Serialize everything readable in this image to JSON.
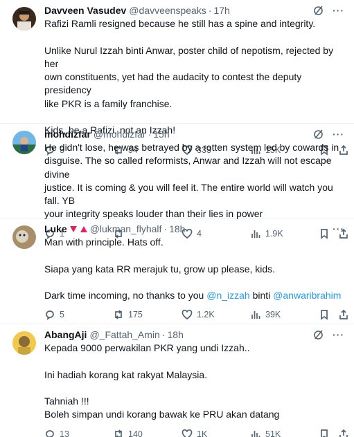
{
  "tweets": [
    {
      "name": "Davveen Vasudev",
      "handle": "@davveenspeaks",
      "time": "17h",
      "lines": [
        "Rafizi Ramli resigned because he still has a spine and integrity.",
        "",
        "Unlike Nurul Izzah binti Anwar, poster child of nepotism, rejected by her",
        "own constituents, yet had the audacity to contest the deputy presidency",
        "like PKR is a family franchise.",
        "",
        "Kids, be a Rafizi, not an Izzah!"
      ],
      "replies": "3",
      "reposts": "54",
      "likes": "333",
      "views": "15K"
    },
    {
      "name": "mohdizfar",
      "handle": "@mohdizfar",
      "time": "15h",
      "lines": [
        "He didn't lose, he was betrayed by a rotten system led by cowards in",
        "disguise. The so called reformists, Anwar and Izzah will not escape divine",
        "justice. It is coming & you will feel it. The entire world will watch you fall. YB",
        "your integrity speaks louder than their lies in power"
      ],
      "replies": "1",
      "reposts": "",
      "likes": "4",
      "views": "1.9K"
    },
    {
      "name": "Luke",
      "handle": "@lukman_flyhalf",
      "time": "18h",
      "lines": [
        "Man with principle. Hats off.",
        "",
        "Siapa yang kata RR merajuk tu, grow up please, kids.",
        ""
      ],
      "last_line_prefix": "Dark time incoming, no thanks to you ",
      "mention1": "@n_izzah",
      "last_line_mid": " binti ",
      "mention2": "@anwaribrahim",
      "replies": "5",
      "reposts": "175",
      "likes": "1.2K",
      "views": "39K"
    },
    {
      "name": "AbangAji",
      "handle": "@_Fattah_Amin",
      "time": "18h",
      "lines": [
        "Kepada 9000 perwakilan PKR yang undi Izzah..",
        "",
        "Ini hadiah korang kat rakyat Malaysia.",
        "",
        "Tahniah !!!",
        "Boleh simpan undi korang bawak ke PRU akan datang"
      ],
      "replies": "13",
      "reposts": "140",
      "likes": "1K",
      "views": "51K"
    }
  ],
  "more_label": "···",
  "dot": "·",
  "colors": {
    "accent": "#1d9bf0",
    "muted": "#536471",
    "text": "#0f1419",
    "divider": "#eff3f4"
  },
  "icons": [
    "reply-icon",
    "repost-icon",
    "like-icon",
    "views-icon",
    "bookmark-icon",
    "share-icon",
    "grok-icon"
  ]
}
